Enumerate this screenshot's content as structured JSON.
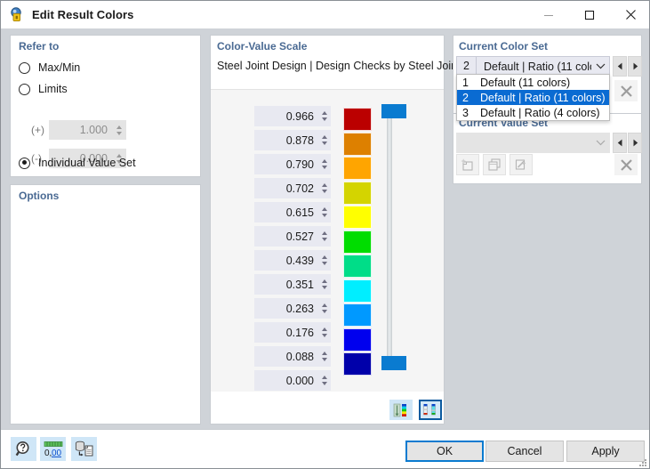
{
  "window": {
    "title": "Edit Result Colors",
    "icon": "result-colors-icon",
    "minimize": "–",
    "maximize": "□",
    "close": "✕"
  },
  "refer_to": {
    "title": "Refer to",
    "options": [
      {
        "label": "Max/Min",
        "checked": false
      },
      {
        "label": "Limits",
        "checked": false
      },
      {
        "label": "Individual Value Set",
        "checked": true
      }
    ],
    "limits": [
      {
        "sign": "(+)",
        "value": "1.000",
        "enabled": false
      },
      {
        "sign": "(-)",
        "value": "0.000",
        "enabled": false
      }
    ]
  },
  "options_panel": {
    "title": "Options"
  },
  "color_value_scale": {
    "title": "Color-Value Scale",
    "subtitle": "Steel Joint Design | Design Checks by Steel Joints",
    "values": [
      "0.966",
      "0.878",
      "0.790",
      "0.702",
      "0.615",
      "0.527",
      "0.439",
      "0.351",
      "0.263",
      "0.176",
      "0.088",
      "0.000"
    ],
    "colors": [
      "#bb0000",
      "#dd8000",
      "#ffa500",
      "#d4d400",
      "#ffff00",
      "#00dd00",
      "#00dd88",
      "#00eeff",
      "#0099ff",
      "#0000ee",
      "#0000aa"
    ],
    "slider": {
      "handle_color": "#0a7bd0"
    },
    "layout_buttons": [
      {
        "name": "scale-layout-gradient",
        "selected": false
      },
      {
        "name": "scale-layout-stepped",
        "selected": true
      }
    ]
  },
  "current_color_set": {
    "title": "Current Color Set",
    "selected": {
      "index": "2",
      "label": "Default | Ratio (11 colors)"
    },
    "chevron": "⌄",
    "prev": "◀",
    "next": "▶",
    "delete": "✕",
    "dropdown_open": true,
    "options": [
      {
        "index": "1",
        "label": "Default (11 colors)",
        "active": false
      },
      {
        "index": "2",
        "label": "Default | Ratio (11 colors)",
        "active": true
      },
      {
        "index": "3",
        "label": "Default | Ratio (4 colors)",
        "active": false
      }
    ]
  },
  "current_value_set": {
    "title": "Current Value Set",
    "selected_label": "",
    "chevron": "⌄",
    "prev": "◀",
    "next": "▶",
    "delete": "✕",
    "buttons": [
      {
        "name": "new-value-set-button",
        "enabled": false
      },
      {
        "name": "copy-value-set-button",
        "enabled": false
      },
      {
        "name": "edit-value-set-button",
        "enabled": false
      }
    ]
  },
  "bottom_toolbar": {
    "buttons": [
      {
        "name": "help-button",
        "icon": "help-magnifier-icon"
      },
      {
        "name": "decimal-places-button",
        "icon": "decimal-places-icon",
        "label": "0,00"
      },
      {
        "name": "export-data-button",
        "icon": "export-database-icon"
      }
    ]
  },
  "dialog_buttons": {
    "ok": "OK",
    "cancel": "Cancel",
    "apply": "Apply"
  }
}
